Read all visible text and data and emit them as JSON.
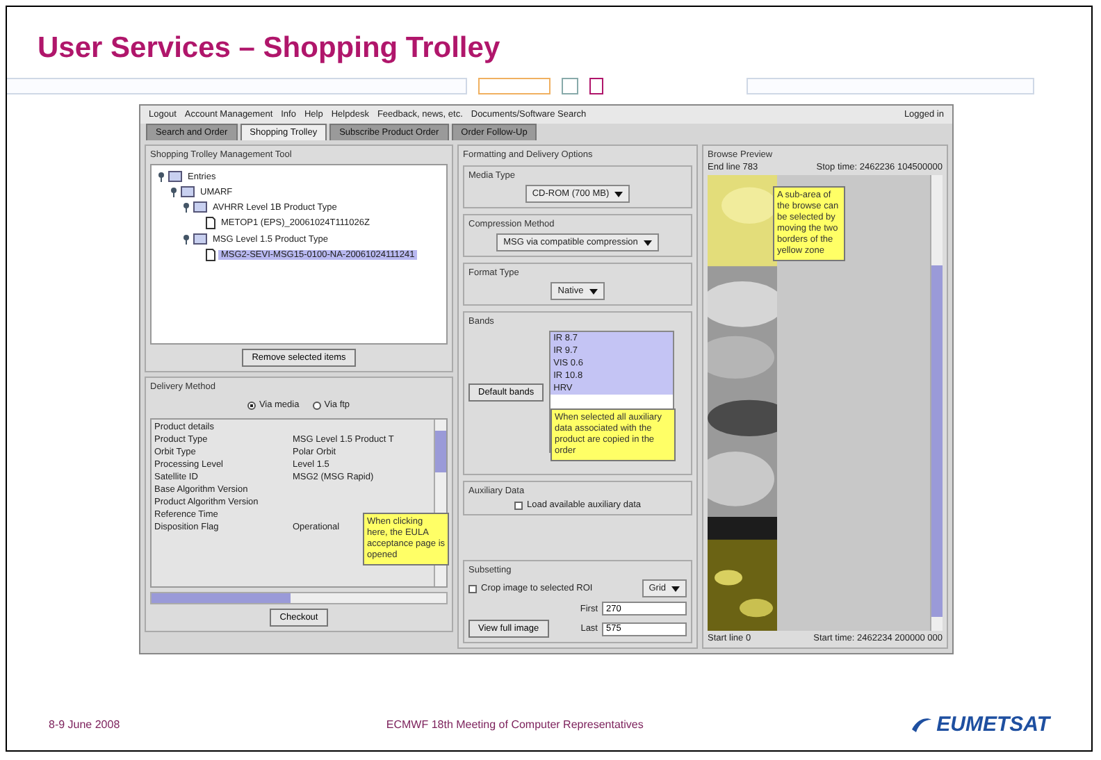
{
  "slide": {
    "title": "User Services – Shopping Trolley",
    "date": "8-9 June 2008",
    "event": "ECMWF 18th Meeting of Computer Representatives",
    "logo": "EUMETSAT"
  },
  "app": {
    "menu": [
      "Logout",
      "Account Management",
      "Info",
      "Help",
      "Helpdesk",
      "Feedback, news, etc.",
      "Documents/Software Search"
    ],
    "status": "Logged in",
    "tabs": [
      {
        "label": "Search and Order",
        "selected": false
      },
      {
        "label": "Shopping Trolley",
        "selected": true
      },
      {
        "label": "Subscribe Product Order",
        "selected": false
      },
      {
        "label": "Order Follow-Up",
        "selected": false
      }
    ],
    "trolley": {
      "title": "Shopping Trolley Management Tool",
      "remove_button": "Remove selected items",
      "tree": [
        {
          "label": "Entries",
          "kind": "folder",
          "expanded": true,
          "selected": false,
          "children": [
            {
              "label": "UMARF",
              "kind": "folder",
              "expanded": true,
              "selected": false,
              "children": [
                {
                  "label": "AVHRR Level 1B Product Type",
                  "kind": "folder",
                  "expanded": true,
                  "selected": false,
                  "children": [
                    {
                      "label": "METOP1 (EPS)_20061024T111026Z",
                      "kind": "file",
                      "selected": false
                    }
                  ]
                },
                {
                  "label": "MSG Level 1.5 Product Type",
                  "kind": "folder",
                  "expanded": true,
                  "selected": false,
                  "children": [
                    {
                      "label": "MSG2-SEVI-MSG15-0100-NA-20061024111241",
                      "kind": "file",
                      "selected": true
                    }
                  ]
                }
              ]
            }
          ]
        }
      ]
    },
    "delivery": {
      "title": "Delivery Method",
      "options": [
        {
          "label": "Via media",
          "selected": true
        },
        {
          "label": "Via ftp",
          "selected": false
        }
      ]
    },
    "details": {
      "title": "Product details",
      "rows": [
        {
          "label": "Product Type",
          "value": "MSG Level 1.5 Product T"
        },
        {
          "label": "Orbit Type",
          "value": "Polar Orbit"
        },
        {
          "label": "Processing Level",
          "value": "Level 1.5"
        },
        {
          "label": "Satellite ID",
          "value": "MSG2 (MSG Rapid)"
        },
        {
          "label": "Base Algorithm Version",
          "value": ""
        },
        {
          "label": "Product Algorithm Version",
          "value": ""
        },
        {
          "label": "Reference Time",
          "value": ""
        },
        {
          "label": "Disposition Flag",
          "value": "Operational"
        }
      ]
    },
    "checkout_button": "Checkout",
    "checkout_note": "When clicking here, the EULA acceptance page is opened",
    "options": {
      "title": "Formatting and Delivery Options",
      "media": {
        "title": "Media Type",
        "value": "CD-ROM (700 MB)"
      },
      "compression": {
        "title": "Compression Method",
        "value": "MSG via compatible compression"
      },
      "format": {
        "title": "Format Type",
        "value": "Native"
      },
      "bands": {
        "title": "Bands",
        "button": "Default bands",
        "note": "When selected all auxiliary data associated with the product are copied in the order",
        "items": [
          {
            "label": "IR 8.7",
            "selected": true
          },
          {
            "label": "IR 9.7",
            "selected": true
          },
          {
            "label": "VIS 0.6",
            "selected": true
          },
          {
            "label": "IR 10.8",
            "selected": true
          },
          {
            "label": "HRV",
            "selected": true
          }
        ]
      },
      "auxiliary": {
        "title": "Auxiliary Data",
        "label": "Load available auxiliary data",
        "checked": false
      },
      "subsetting": {
        "title": "Subsetting",
        "crop_label": "Crop image to selected ROI",
        "checked": false,
        "grid": "Grid",
        "first_label": "First",
        "first_value": "270",
        "last_label": "Last",
        "last_value": "575",
        "button": "View full image"
      }
    },
    "preview": {
      "title": "Browse Preview",
      "top_left": "End line 783",
      "top_right": "Stop time: 2462236 104500000",
      "bottom_left": "Start line 0",
      "bottom_right": "Start time: 2462234 200000 000",
      "note": "A sub-area of the browse can be selected by moving the two borders of the yellow zone"
    }
  }
}
